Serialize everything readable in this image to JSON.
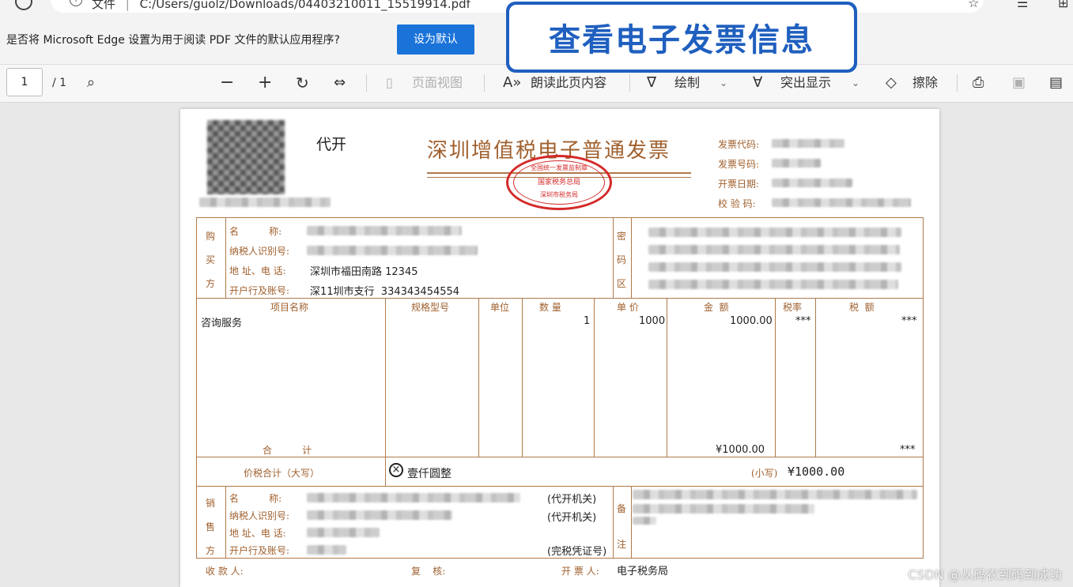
{
  "browser": {
    "url_prefix": "文件",
    "url_separator": "|",
    "url": "C:/Users/guolz/Downloads/04403210011_15519914.pdf"
  },
  "default_prompt": {
    "question": "是否将 Microsoft Edge 设置为用于阅读 PDF 文件的默认应用程序?",
    "button": "设为默认"
  },
  "banner": {
    "text": "查看电子发票信息"
  },
  "toolbar": {
    "page_current": "1",
    "page_total": "/ 1",
    "page_view": "页面视图",
    "read_aloud": "朗读此页内容",
    "draw": "绘制",
    "highlight": "突出显示",
    "erase": "擦除"
  },
  "invoice": {
    "agent_issue": "代开",
    "title": "深圳增值税电子普通发票",
    "stamp_top": "全国统一发票监制章",
    "stamp_mid": "国家税务总局",
    "stamp_bottom": "深圳市税务局",
    "meta_labels": [
      "发票代码:",
      "发票号码:",
      "开票日期:",
      "校 验 码:"
    ],
    "buyer": {
      "side_label": [
        "购",
        "买",
        "方"
      ],
      "name_label": "名          称:",
      "tax_id_label": "纳税人识别号:",
      "address_label": "地 址、电 话:",
      "address_value": "深圳市福田南路 12345",
      "bank_label": "开户行及账号:",
      "bank_value": "深11圳市支行  334343454554"
    },
    "cipher_label": [
      "密",
      "码",
      "区"
    ],
    "columns": [
      "项目名称",
      "规格型号",
      "单位",
      "数 量",
      "单 价",
      "金  额",
      "税率",
      "税  额"
    ],
    "item": {
      "name": "咨询服务",
      "quantity": "1",
      "unit_price": "1000",
      "amount": "1000.00",
      "tax_rate": "***",
      "tax": "***"
    },
    "total_label": "合          计",
    "total_amount": "¥1000.00",
    "total_tax": "***",
    "grand_label": "价税合计（大写）",
    "grand_upper": "壹仟圆整",
    "grand_small_label": "(小写)",
    "grand_small_value": "¥1000.00",
    "seller": {
      "side_label": [
        "销",
        "售",
        "方"
      ],
      "name_label": "名          称:",
      "name_note": "(代开机关)",
      "tax_id_label": "纳税人识别号:",
      "tax_id_note": "(代开机关)",
      "address_label": "地 址、电 话:",
      "bank_label": "开户行及账号:",
      "bank_note": "(完税凭证号)"
    },
    "remark_label": [
      "备",
      "注"
    ],
    "payee_label": "收 款 人:",
    "reviewer_label": "复    核:",
    "drawer_label": "开 票 人:",
    "drawer_value": "电子税务局"
  },
  "watermark": "CSDN @从码农到码到成功",
  "colors": {
    "accent": "#1a73d9",
    "invoice": "#a0602e",
    "stamp": "#d42a2a",
    "banner": "#1f5fbf"
  }
}
